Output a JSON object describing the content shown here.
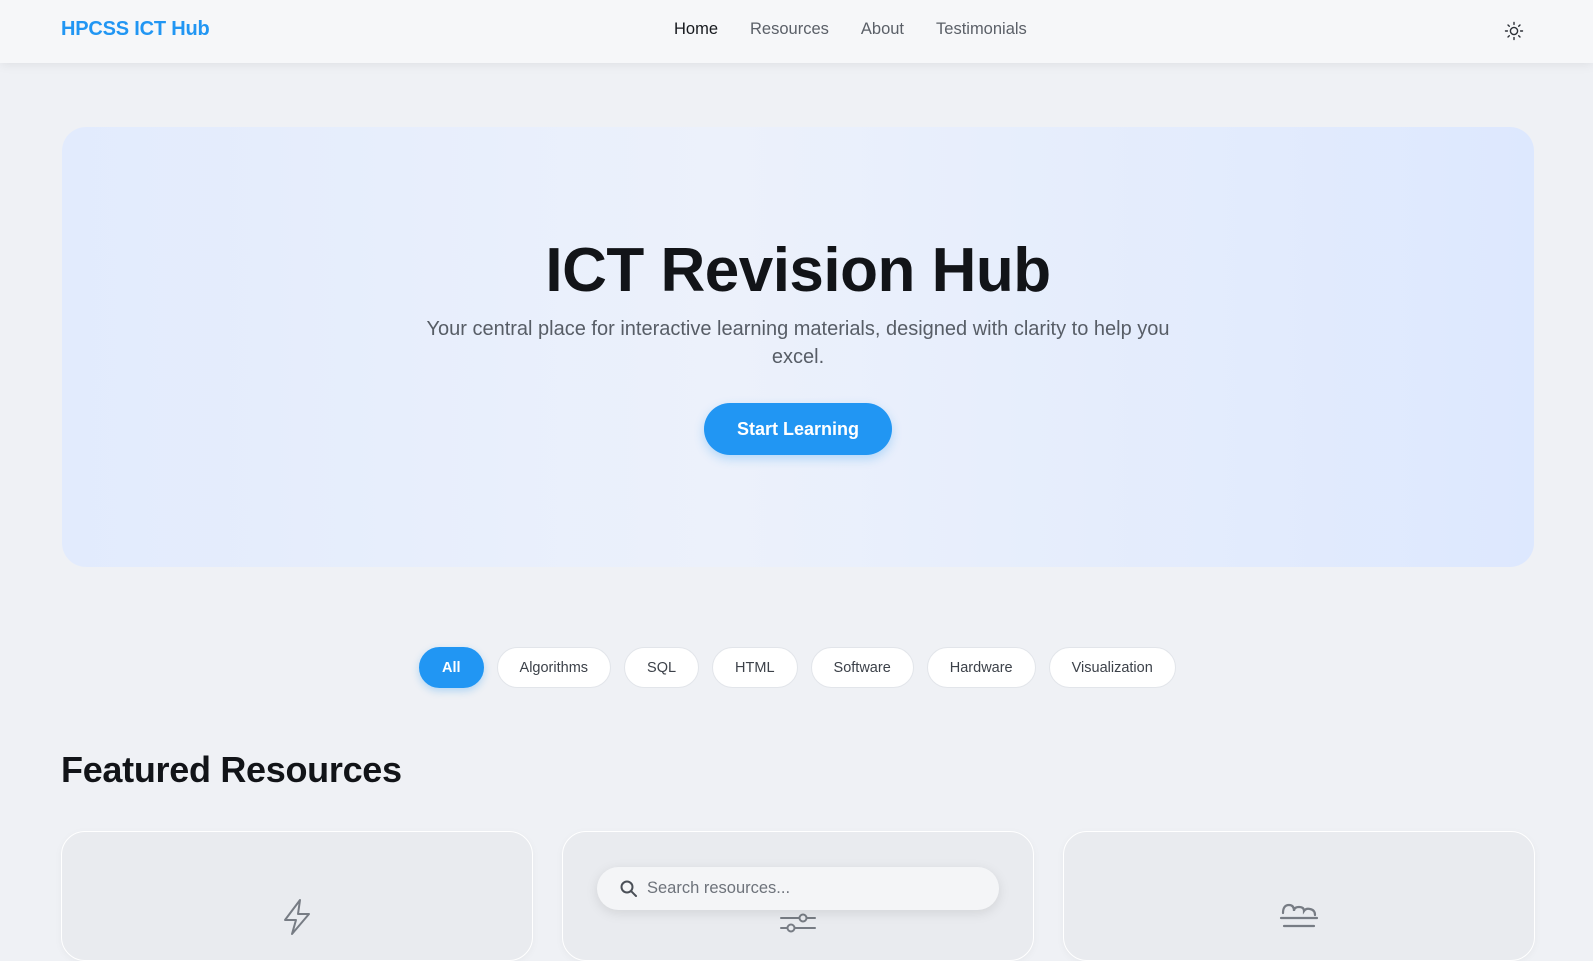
{
  "nav": {
    "brand": "HPCSS ICT Hub",
    "links": [
      {
        "label": "Home",
        "active": true
      },
      {
        "label": "Resources",
        "active": false
      },
      {
        "label": "About",
        "active": false
      },
      {
        "label": "Testimonials",
        "active": false
      }
    ],
    "theme_icon": "sun-icon"
  },
  "hero": {
    "title": "ICT Revision Hub",
    "subtitle": "Your central place for interactive learning materials, designed with clarity to help you excel.",
    "cta_label": "Start Learning"
  },
  "filters": [
    {
      "label": "All",
      "active": true
    },
    {
      "label": "Algorithms",
      "active": false
    },
    {
      "label": "SQL",
      "active": false
    },
    {
      "label": "HTML",
      "active": false
    },
    {
      "label": "Software",
      "active": false
    },
    {
      "label": "Hardware",
      "active": false
    },
    {
      "label": "Visualization",
      "active": false
    }
  ],
  "featured": {
    "title": "Featured Resources",
    "cards": [
      {
        "icon": "lightning-icon"
      },
      {
        "icon": "sliders-icon"
      },
      {
        "icon": "weight-scale-icon"
      }
    ]
  },
  "search": {
    "placeholder": "Search resources...",
    "icon": "search-icon"
  },
  "colors": {
    "accent": "#2196f3",
    "background": "#eff1f5"
  }
}
